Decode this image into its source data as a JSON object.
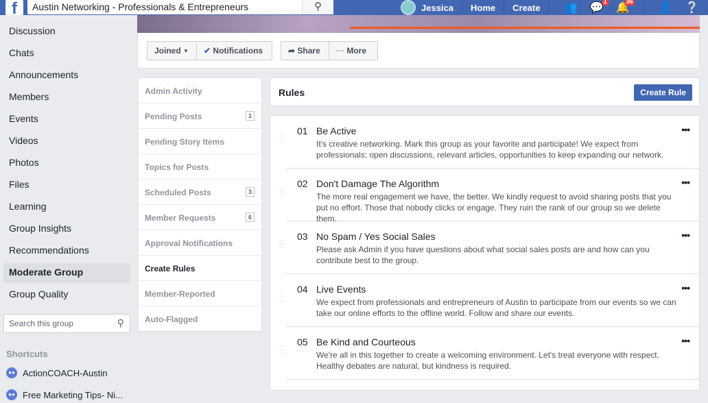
{
  "topbar": {
    "logo": "f",
    "search_value": "Austin Networking - Professionals & Entrepreneurs",
    "user": "Jessica",
    "home": "Home",
    "create": "Create",
    "messenger_badge": "1",
    "notifications_badge": "36"
  },
  "sidebar": {
    "items": [
      "Discussion",
      "Chats",
      "Announcements",
      "Members",
      "Events",
      "Videos",
      "Photos",
      "Files",
      "Learning",
      "Group Insights",
      "Recommendations",
      "Moderate Group",
      "Group Quality"
    ],
    "active": "Moderate Group",
    "search_placeholder": "Search this group",
    "shortcuts_label": "Shortcuts",
    "shortcuts": [
      "ActionCOACH-Austin",
      "Free Marketing Tips- Ni..."
    ]
  },
  "actions": {
    "joined": "Joined",
    "notifications": "Notifications",
    "share": "Share",
    "more": "More"
  },
  "moderation": {
    "items": [
      {
        "label": "Admin Activity"
      },
      {
        "label": "Pending Posts",
        "count": "1"
      },
      {
        "label": "Pending Story Items"
      },
      {
        "label": "Topics for Posts"
      },
      {
        "label": "Scheduled Posts",
        "count": "3"
      },
      {
        "label": "Member Requests",
        "count": "6"
      },
      {
        "label": "Approval Notifications"
      },
      {
        "label": "Create Rules"
      },
      {
        "label": "Member-Reported"
      },
      {
        "label": "Auto-Flagged"
      }
    ]
  },
  "rules": {
    "title": "Rules",
    "create_button": "Create Rule",
    "items": [
      {
        "num": "01",
        "title": "Be Active",
        "desc": "It's creative networking. Mark this group as your favorite and participate! We expect from professionals: open discussions, relevant articles, opportunities to keep expanding our network."
      },
      {
        "num": "02",
        "title": "Don't Damage The Algorithm",
        "desc": "The more real engagement we have, the better. We kindly request to avoid sharing posts that you put no effort. Those that nobody clicks or engage. They ruin the rank of our group so we delete them."
      },
      {
        "num": "03",
        "title": "No Spam / Yes Social Sales",
        "desc": "Please ask Admin if you have questions about what social sales posts are and how can you contribute best to the group."
      },
      {
        "num": "04",
        "title": "Live Events",
        "desc": "We expect from professionals and entrepreneurs of Austin to participate from our events so we can take our online efforts to the offline world. Follow and share our events."
      },
      {
        "num": "05",
        "title": "Be Kind and Courteous",
        "desc": "We're all in this together to create a welcoming environment. Let's treat everyone with respect. Healthy debates are natural, but kindness is required."
      }
    ]
  }
}
